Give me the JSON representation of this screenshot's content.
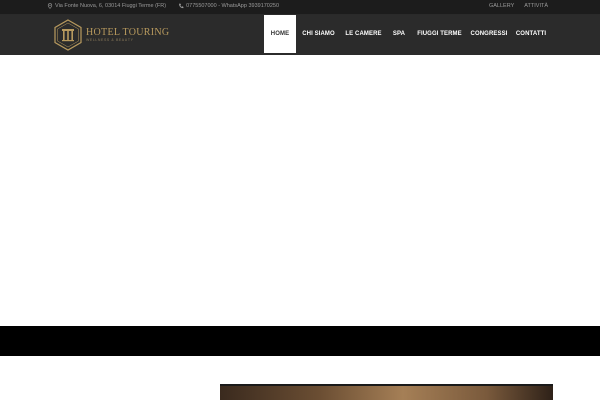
{
  "topbar": {
    "address": "Via Fonte Nuova, 6, 03014 Fiuggi Terme (FR)",
    "phone": "0775507000 - WhatsApp 3939170250",
    "links": [
      "GALLERY",
      "ATTIVITÀ"
    ]
  },
  "logo": {
    "name": "HOTEL TOURING",
    "tagline": "WELLNESS & BEAUTY"
  },
  "nav": {
    "items": [
      {
        "label": "HOME",
        "active": true
      },
      {
        "label": "CHI SIAMO",
        "active": false
      },
      {
        "label": "LE CAMERE",
        "active": false
      },
      {
        "label": "SPA",
        "active": false
      },
      {
        "label": "FIUGGI TERME",
        "active": false
      },
      {
        "label": "CONGRESSI",
        "active": false
      },
      {
        "label": "CONTATTI",
        "active": false
      }
    ]
  },
  "colors": {
    "topbar_bg": "#1c1c1c",
    "header_bg": "#2b2b2b",
    "gold": "#b89a5e",
    "band": "#000000"
  }
}
